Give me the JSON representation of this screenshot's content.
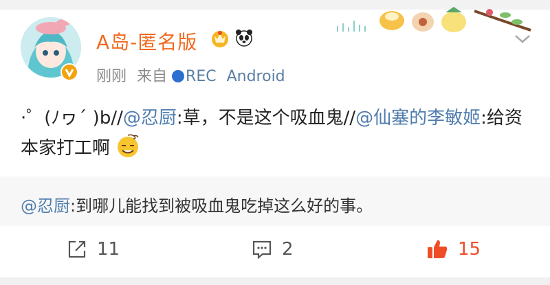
{
  "post": {
    "username": "A岛-匿名版",
    "badges": [
      "crown-badge-icon",
      "panda-icon"
    ],
    "meta": {
      "time": "刚刚",
      "source_prefix": "来自",
      "source_rec": "REC",
      "source_device": "Android"
    },
    "content": {
      "part1": "·゜(ﾉヮ´ )b//",
      "mention1": "@忍厨",
      "part2": ":草，不是这个吸血鬼//",
      "mention2": "@仙塞的李敏姬",
      "part3": ":给资本家打工啊",
      "emoji": "dizzy-face-emoji"
    },
    "repost": {
      "mention": "@忍厨",
      "text": ":到哪儿能找到被吸血鬼吃掉这么好的事。"
    },
    "actions": {
      "share_count": "11",
      "comment_count": "2",
      "like_count": "15"
    }
  },
  "colors": {
    "username": "#f06a1f",
    "link": "#4f7cae",
    "like": "#ef4c28",
    "meta": "#8a8a8a"
  }
}
